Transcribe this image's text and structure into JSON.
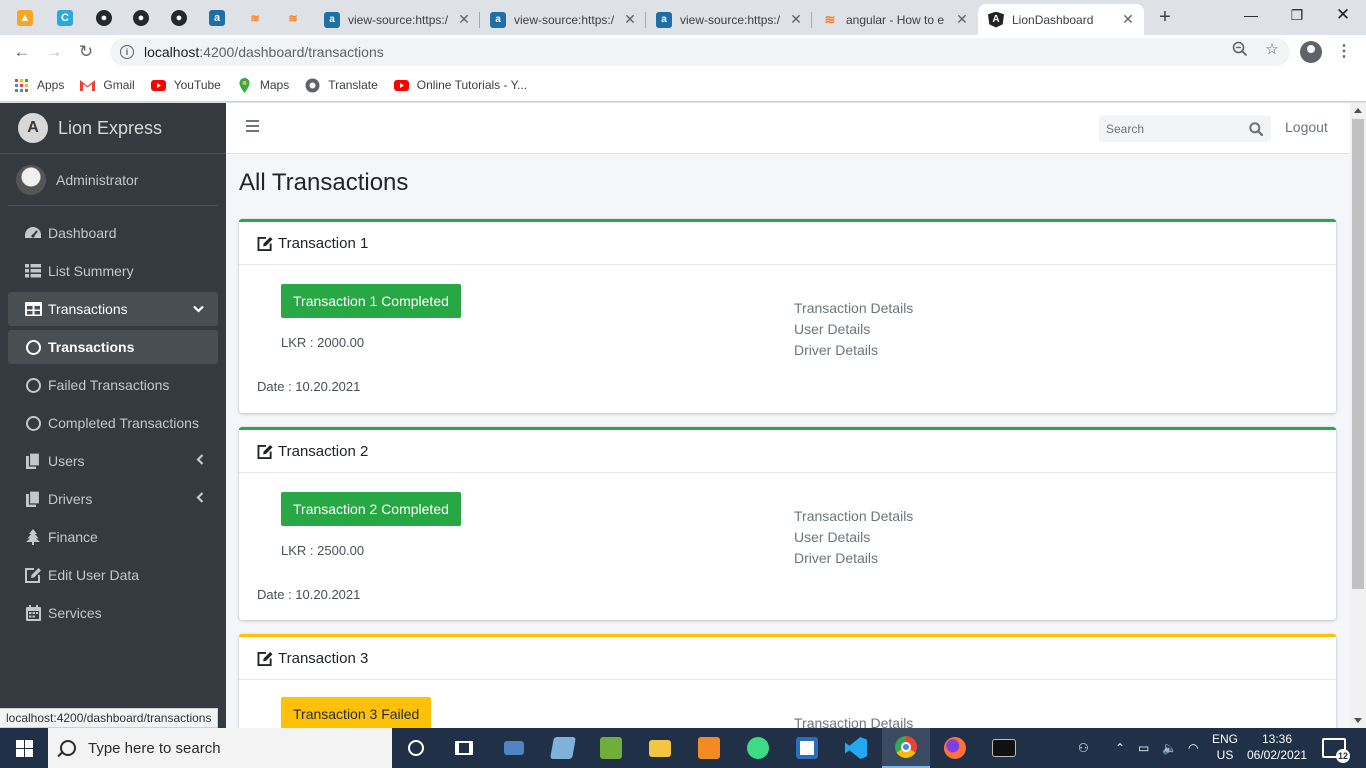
{
  "browser": {
    "tabs": [
      {
        "title": "view-source:https:/",
        "favicon": "a-icon"
      },
      {
        "title": "view-source:https:/",
        "favicon": "a-icon"
      },
      {
        "title": "view-source:https:/",
        "favicon": "a-icon"
      },
      {
        "title": "angular - How to e",
        "favicon": "stackoverflow-icon"
      },
      {
        "title": "LionDashboard",
        "favicon": "angular-icon",
        "active": true
      }
    ],
    "new_tab_label": "+",
    "address": {
      "host": "localhost",
      "path": ":4200/dashboard/transactions"
    },
    "bookmarks": [
      {
        "label": "Apps",
        "icon": "apps-grid-icon"
      },
      {
        "label": "Gmail",
        "icon": "gmail-icon"
      },
      {
        "label": "YouTube",
        "icon": "youtube-icon"
      },
      {
        "label": "Maps",
        "icon": "maps-icon"
      },
      {
        "label": "Translate",
        "icon": "translate-icon"
      },
      {
        "label": "Online Tutorials - Y...",
        "icon": "youtube-icon"
      }
    ],
    "status_url": "localhost:4200/dashboard/transactions"
  },
  "sidebar": {
    "brand": "Lion Express",
    "user": "Administrator",
    "items": [
      {
        "label": "Dashboard",
        "icon": "dashboard-icon"
      },
      {
        "label": "List Summery",
        "icon": "list-icon"
      },
      {
        "label": "Transactions",
        "icon": "table-icon",
        "open": true
      },
      {
        "label": "Transactions",
        "icon": "circle-icon",
        "current": true
      },
      {
        "label": "Failed Transactions",
        "icon": "circle-icon"
      },
      {
        "label": "Completed Transactions",
        "icon": "circle-icon"
      },
      {
        "label": "Users",
        "icon": "copy-icon"
      },
      {
        "label": "Drivers",
        "icon": "copy-icon"
      },
      {
        "label": "Finance",
        "icon": "tree-icon"
      },
      {
        "label": "Edit User Data",
        "icon": "edit-icon"
      },
      {
        "label": "Services",
        "icon": "calendar-icon"
      }
    ]
  },
  "topnav": {
    "search_placeholder": "Search",
    "logout_label": "Logout"
  },
  "page": {
    "title": "All Transactions"
  },
  "transactions": [
    {
      "header": "Transaction 1",
      "status_label": "Transaction 1 Completed",
      "status": "completed",
      "amount": "LKR : 2000.00",
      "date": "Date : 10.20.2021",
      "links": [
        "Transaction Details",
        "User Details",
        "Driver Details"
      ]
    },
    {
      "header": "Transaction 2",
      "status_label": "Transaction 2 Completed",
      "status": "completed",
      "amount": "LKR : 2500.00",
      "date": "Date : 10.20.2021",
      "links": [
        "Transaction Details",
        "User Details",
        "Driver Details"
      ]
    },
    {
      "header": "Transaction 3",
      "status_label": "Transaction 3 Failed",
      "status": "failed",
      "links": [
        "Transaction Details"
      ]
    }
  ],
  "taskbar": {
    "search_placeholder": "Type here to search",
    "lang_1": "ENG",
    "lang_2": "US",
    "time": "13:36",
    "date": "06/02/2021",
    "notifications": "12"
  },
  "colors": {
    "sidebar_bg": "#343a40",
    "success": "#28a745",
    "warning": "#ffc107",
    "content_bg": "#f4f6f9"
  }
}
